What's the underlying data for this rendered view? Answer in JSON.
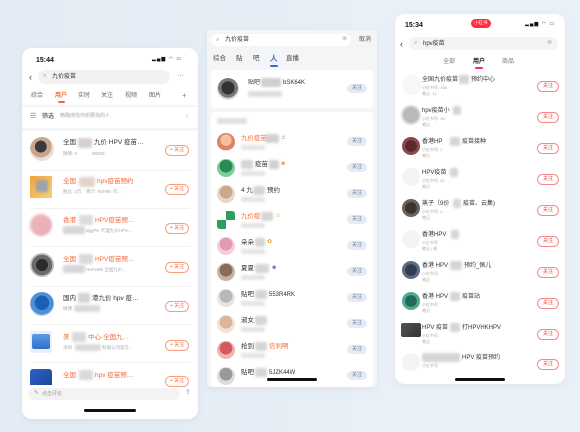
{
  "left": {
    "status_time": "15:44",
    "search_query": "九价疫苗",
    "more": "···",
    "tabs": [
      "综合",
      "用户",
      "实时",
      "关注",
      "视频",
      "图片"
    ],
    "add_tab": "+",
    "filter_label": "筛选",
    "filter_hint": "精确搜找你想要找的人",
    "rows": [
      {
        "name": "全国",
        "name2": "九价 HPV 疫苗…",
        "meta": "微博: 5",
        "meta2": "98600",
        "btn": "+ 关注"
      },
      {
        "name": "全国",
        "name2": "hpv疫苗预约",
        "meta": "粉丝: 4万",
        "meta2": "简介: Nch99. 作…",
        "btn": "+ 关注"
      },
      {
        "name": "香港",
        "name2": "HPV疫苗预…",
        "meta": "",
        "meta2": "dggPK 代理九价HPV…",
        "btn": "+ 关注"
      },
      {
        "name": "全国",
        "name2": "HPV疫苗预…",
        "meta": "",
        "meta2": "HeFei98 全国九价…",
        "btn": "+ 关注"
      },
      {
        "name": "国内",
        "name2": "港九价 hpv 疫…",
        "meta": "微博",
        "meta2": "",
        "btn": "+ 关注"
      },
      {
        "name": "美",
        "name2": "中心-全国九…",
        "meta": "深圳",
        "meta2": "有限公司官方…",
        "btn": "+ 关注"
      },
      {
        "name": "全国",
        "name2": "hpv 疫苗预…",
        "meta": "",
        "meta2": "",
        "btn": "+ 关注"
      }
    ],
    "bottom_input": "点击评论",
    "bottom_icon": "share-icon"
  },
  "middle": {
    "search_query": "九价疫苗",
    "cancel": "取消",
    "tabs": [
      "综合",
      "贴",
      "吧",
      "人",
      "直播"
    ],
    "top_card": {
      "name": "贴吧",
      "name2": "bSK64K",
      "sub": "",
      "btn": "关注"
    },
    "rows": [
      {
        "name": "九价疫苗",
        "name2": "",
        "sub": "",
        "btn": "关注"
      },
      {
        "name": "疫苗",
        "name2": "",
        "sub": "",
        "btn": "关注"
      },
      {
        "name": "4 九",
        "name2": "预约",
        "sub": "",
        "btn": "关注"
      },
      {
        "name": "九价疫",
        "name2": "",
        "sub": "",
        "btn": "关注"
      },
      {
        "name": "朵朵",
        "name2": "",
        "sub": "",
        "btn": "关注"
      },
      {
        "name": "夏夏",
        "name2": "",
        "sub": "",
        "btn": "关注"
      },
      {
        "name": "贴吧",
        "name2": "553R4RK",
        "sub": "",
        "btn": "关注"
      },
      {
        "name": "淑女",
        "name2": "",
        "sub": "",
        "btn": "关注"
      },
      {
        "name": "抢到",
        "name2": "信刹啊",
        "sub": "",
        "btn": "关注"
      },
      {
        "name": "贴吧",
        "name2": "5JZK44W",
        "sub": "",
        "btn": "关注"
      }
    ]
  },
  "right": {
    "status_time": "15:34",
    "badge": "小红书",
    "search_query": "hpv疫苗",
    "tabs": [
      "全部",
      "用户",
      "商品"
    ],
    "rows": [
      {
        "name": "全国九价疫苗",
        "name2": "预约中心",
        "meta": "小红书号: 288",
        "meta2": "笔记: 11",
        "btn": "关注"
      },
      {
        "name": "hpv疫苗小",
        "name2": "",
        "meta": "小红书号: 96",
        "meta2": "笔记",
        "btn": "关注"
      },
      {
        "name": "香港HP",
        "name2": "疫苗接种",
        "meta": "小红书号: 1",
        "meta2": "笔记",
        "btn": "关注"
      },
      {
        "name": "HPV疫苗",
        "name2": "",
        "meta": "小红书号: 91",
        "meta2": "笔记",
        "btn": "关注"
      },
      {
        "name": "蒸子（9价",
        "name2": "疫苗、云集)",
        "meta": "小红书号: 3",
        "meta2": "笔记",
        "btn": "关注"
      },
      {
        "name": "香港HPV",
        "name2": "",
        "meta": "小红书号",
        "meta2": "笔记 | 粉",
        "btn": "关注"
      },
      {
        "name": "香港 HPV",
        "name2": "预约_佩儿",
        "meta": "小红书号",
        "meta2": "笔记",
        "btn": "关注"
      },
      {
        "name": "香港 HPV",
        "name2": "疫苗站",
        "meta": "小红书号",
        "meta2": "笔记",
        "btn": "关注"
      },
      {
        "name": "HPV 疫苗",
        "name2": "打HPVHKHPV",
        "meta": "小红书号",
        "meta2": "笔记",
        "btn": "关注"
      },
      {
        "name": "",
        "name2": "HPV 疫苗预约",
        "meta": "小红书号",
        "meta2": "",
        "btn": "关注"
      }
    ]
  },
  "colors": {
    "orange": "#f06b3b",
    "red": "#e84545",
    "blue_btn": "#e6ebf3"
  }
}
